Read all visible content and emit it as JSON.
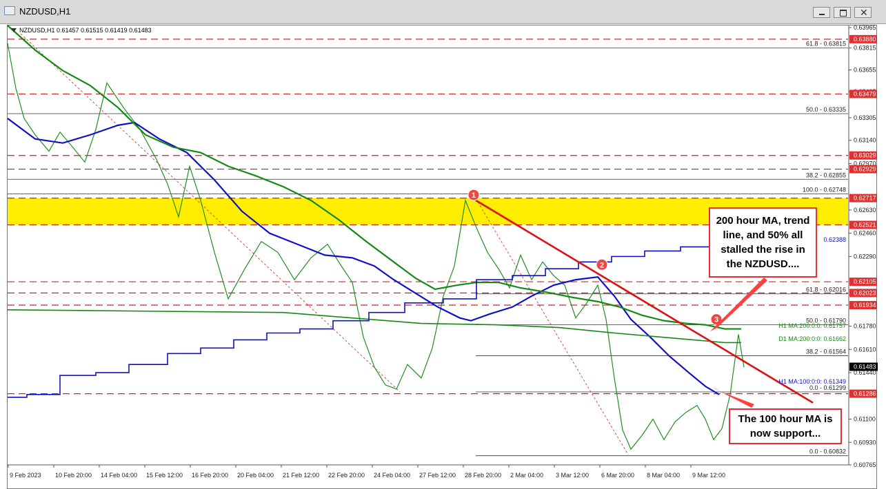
{
  "window": {
    "title": "NZDUSD,H1",
    "symbol_icon": "chart-window-icon",
    "buttons": [
      "minimize-icon",
      "restore-icon",
      "close-icon"
    ]
  },
  "chart_info": "NZDUSD,H1  0.61457 0.61515 0.61419 0.61483",
  "colors": {
    "candle": "#1f8f1f",
    "ma100": "#1010c8",
    "ma200": "#138a13",
    "trendline": "#e01010",
    "zone": "#ffee00",
    "level_line": "#cc2222",
    "price_tag": "#e03030"
  },
  "chart_data": {
    "type": "line",
    "symbol": "NZDUSD",
    "timeframe": "H1",
    "ylim": [
      0.60765,
      0.6398
    ],
    "x_ticks": [
      "9 Feb 2023",
      "10 Feb 20:00",
      "14 Feb 04:00",
      "15 Feb 12:00",
      "16 Feb 20:00",
      "20 Feb 04:00",
      "21 Feb 12:00",
      "22 Feb 20:00",
      "24 Feb 04:00",
      "27 Feb 12:00",
      "28 Feb 20:00",
      "2 Mar 04:00",
      "3 Mar 12:00",
      "6 Mar 20:00",
      "8 Mar 04:00",
      "9 Mar 12:00"
    ],
    "y_ticks": [
      "0.63965",
      "0.63815",
      "0.63655",
      "0.63495",
      "0.63305",
      "0.63140",
      "0.62970",
      "0.62630",
      "0.62460",
      "0.62290",
      "0.61780",
      "0.61610",
      "0.61440",
      "0.61100",
      "0.60930",
      "0.60765"
    ],
    "price_tags": [
      {
        "label": "0.63880",
        "value": 0.6388
      },
      {
        "label": "0.63479",
        "value": 0.63479
      },
      {
        "label": "0.63029",
        "value": 0.63029
      },
      {
        "label": "0.62929",
        "value": 0.62929
      },
      {
        "label": "0.62717",
        "value": 0.62717
      },
      {
        "label": "0.62521",
        "value": 0.62521
      },
      {
        "label": "0.62105",
        "value": 0.62105
      },
      {
        "label": "0.62023",
        "value": 0.62023
      },
      {
        "label": "0.61934",
        "value": 0.61934
      },
      {
        "label": "0.61286",
        "value": 0.61286
      }
    ],
    "current_price": {
      "label": "0.61483",
      "value": 0.61483
    },
    "resistance_zone": [
      0.62521,
      0.62717
    ],
    "fib_upper": [
      {
        "label": "61.8 - 0.63815",
        "value": 0.63815
      },
      {
        "label": "50.0 - 0.63335",
        "value": 0.63335
      },
      {
        "label": "38.2 - 0.62855",
        "value": 0.62855
      },
      {
        "label": "100.0 - 0.62748",
        "value": 0.62748
      }
    ],
    "fib_lower": [
      {
        "label": "61.8 - 0.62016",
        "value": 0.62016
      },
      {
        "label": "50.0 - 0.61790",
        "value": 0.6179
      },
      {
        "label": "38.2 - 0.61564",
        "value": 0.61564
      },
      {
        "label": "0.0 - 0.61299",
        "value": 0.61299
      },
      {
        "label": "0.0 - 0.60832",
        "value": 0.60832
      }
    ],
    "ma_labels": [
      {
        "label": "H1 MA:200:0:0: 0.61757",
        "value": 0.61757,
        "color": "#138a13"
      },
      {
        "label": "D1 MA:200:0:0: 0.61662",
        "value": 0.61662,
        "color": "#138a13"
      },
      {
        "label": "H1 MA:100:0:0: 0.61349",
        "value": 0.61349,
        "color": "#1010c8"
      },
      {
        "label": "0.62388",
        "value": 0.62388,
        "color": "#1010c8"
      }
    ],
    "series": [
      {
        "values": [
          [
            0,
            0.6385
          ],
          [
            6,
            0.6352
          ],
          [
            12,
            0.633
          ],
          [
            20,
            0.6318
          ],
          [
            30,
            0.6306
          ],
          [
            38,
            0.632
          ],
          [
            48,
            0.6308
          ],
          [
            56,
            0.6298
          ],
          [
            64,
            0.6322
          ],
          [
            72,
            0.6356
          ],
          [
            84,
            0.6338
          ],
          [
            96,
            0.6322
          ],
          [
            108,
            0.63
          ],
          [
            116,
            0.6282
          ],
          [
            124,
            0.6258
          ],
          [
            132,
            0.6295
          ],
          [
            140,
            0.627
          ],
          [
            150,
            0.6232
          ],
          [
            160,
            0.6198
          ],
          [
            172,
            0.622
          ],
          [
            184,
            0.624
          ],
          [
            196,
            0.6232
          ],
          [
            208,
            0.6212
          ],
          [
            220,
            0.6228
          ],
          [
            232,
            0.6238
          ],
          [
            242,
            0.6222
          ],
          [
            250,
            0.621
          ],
          [
            258,
            0.617
          ],
          [
            266,
            0.6148
          ],
          [
            274,
            0.6135
          ],
          [
            282,
            0.6132
          ],
          [
            290,
            0.615
          ],
          [
            300,
            0.614
          ],
          [
            308,
            0.6162
          ],
          [
            316,
            0.62
          ],
          [
            324,
            0.6222
          ],
          [
            332,
            0.627
          ],
          [
            340,
            0.625
          ],
          [
            348,
            0.6232
          ],
          [
            356,
            0.622
          ],
          [
            364,
            0.6206
          ],
          [
            372,
            0.623
          ],
          [
            380,
            0.6212
          ],
          [
            388,
            0.6225
          ],
          [
            396,
            0.6215
          ],
          [
            404,
            0.6208
          ],
          [
            412,
            0.6184
          ],
          [
            420,
            0.6195
          ],
          [
            428,
            0.6208
          ],
          [
            434,
            0.6183
          ],
          [
            440,
            0.614
          ],
          [
            446,
            0.6102
          ],
          [
            452,
            0.6088
          ],
          [
            460,
            0.6098
          ],
          [
            468,
            0.611
          ],
          [
            476,
            0.6095
          ],
          [
            484,
            0.6108
          ],
          [
            492,
            0.6115
          ],
          [
            500,
            0.612
          ],
          [
            506,
            0.611
          ],
          [
            512,
            0.6095
          ],
          [
            518,
            0.6103
          ],
          [
            524,
            0.6128
          ],
          [
            530,
            0.6172
          ],
          [
            534,
            0.6148
          ]
        ]
      },
      {
        "name": "H1 MA 100",
        "values": [
          [
            0,
            0.633
          ],
          [
            20,
            0.6315
          ],
          [
            40,
            0.6312
          ],
          [
            60,
            0.6318
          ],
          [
            80,
            0.6325
          ],
          [
            92,
            0.6327
          ],
          [
            110,
            0.6315
          ],
          [
            130,
            0.6305
          ],
          [
            150,
            0.6285
          ],
          [
            170,
            0.6262
          ],
          [
            190,
            0.6246
          ],
          [
            210,
            0.6238
          ],
          [
            230,
            0.623
          ],
          [
            250,
            0.6228
          ],
          [
            266,
            0.6222
          ],
          [
            280,
            0.6212
          ],
          [
            296,
            0.6202
          ],
          [
            312,
            0.6192
          ],
          [
            328,
            0.6184
          ],
          [
            336,
            0.6182
          ],
          [
            350,
            0.6187
          ],
          [
            366,
            0.6192
          ],
          [
            380,
            0.62
          ],
          [
            396,
            0.6208
          ],
          [
            412,
            0.6212
          ],
          [
            428,
            0.6214
          ],
          [
            440,
            0.62
          ],
          [
            452,
            0.6183
          ],
          [
            466,
            0.617
          ],
          [
            480,
            0.6156
          ],
          [
            494,
            0.6144
          ],
          [
            506,
            0.6134
          ],
          [
            516,
            0.6128
          ]
        ]
      },
      {
        "name": "H1 MA 200",
        "values": [
          [
            0,
            0.6398
          ],
          [
            20,
            0.638
          ],
          [
            40,
            0.6365
          ],
          [
            60,
            0.6354
          ],
          [
            80,
            0.6338
          ],
          [
            100,
            0.6318
          ],
          [
            120,
            0.6309
          ],
          [
            140,
            0.6305
          ],
          [
            160,
            0.6295
          ],
          [
            180,
            0.6288
          ],
          [
            200,
            0.628
          ],
          [
            220,
            0.627
          ],
          [
            240,
            0.6256
          ],
          [
            260,
            0.624
          ],
          [
            280,
            0.6225
          ],
          [
            296,
            0.6213
          ],
          [
            310,
            0.6205
          ],
          [
            326,
            0.6208
          ],
          [
            340,
            0.621
          ],
          [
            356,
            0.621
          ],
          [
            372,
            0.6206
          ],
          [
            390,
            0.6203
          ],
          [
            410,
            0.6199
          ],
          [
            428,
            0.6196
          ],
          [
            444,
            0.6192
          ],
          [
            460,
            0.6186
          ],
          [
            476,
            0.6182
          ],
          [
            492,
            0.618
          ],
          [
            506,
            0.6179
          ],
          [
            520,
            0.6176
          ],
          [
            532,
            0.6176
          ]
        ]
      },
      {
        "name": "D1 MA 200",
        "values": [
          [
            0,
            0.619
          ],
          [
            100,
            0.6189
          ],
          [
            200,
            0.6188
          ],
          [
            300,
            0.618
          ],
          [
            354,
            0.6179
          ],
          [
            400,
            0.6177
          ],
          [
            440,
            0.6173
          ],
          [
            474,
            0.617
          ],
          [
            520,
            0.6166
          ],
          [
            532,
            0.6166
          ]
        ]
      },
      {
        "name": "D1 MA 100",
        "values": [
          [
            0,
            0.6126
          ],
          [
            14,
            0.6126
          ],
          [
            14,
            0.6128
          ],
          [
            38,
            0.6128
          ],
          [
            38,
            0.6142
          ],
          [
            64,
            0.6142
          ],
          [
            64,
            0.6144
          ],
          [
            88,
            0.6144
          ],
          [
            88,
            0.615
          ],
          [
            116,
            0.615
          ],
          [
            116,
            0.6158
          ],
          [
            140,
            0.6158
          ],
          [
            140,
            0.6162
          ],
          [
            164,
            0.6162
          ],
          [
            164,
            0.6168
          ],
          [
            188,
            0.6168
          ],
          [
            188,
            0.6173
          ],
          [
            212,
            0.6173
          ],
          [
            212,
            0.6176
          ],
          [
            236,
            0.6176
          ],
          [
            236,
            0.6182
          ],
          [
            262,
            0.6182
          ],
          [
            262,
            0.6188
          ],
          [
            288,
            0.6188
          ],
          [
            288,
            0.6195
          ],
          [
            316,
            0.6195
          ],
          [
            316,
            0.6198
          ],
          [
            340,
            0.6198
          ],
          [
            340,
            0.6212
          ],
          [
            366,
            0.6212
          ],
          [
            366,
            0.6215
          ],
          [
            390,
            0.6215
          ],
          [
            390,
            0.622
          ],
          [
            414,
            0.622
          ],
          [
            414,
            0.6225
          ],
          [
            438,
            0.6225
          ],
          [
            438,
            0.6229
          ],
          [
            462,
            0.6229
          ],
          [
            462,
            0.6233
          ],
          [
            488,
            0.6233
          ],
          [
            488,
            0.6236
          ],
          [
            514,
            0.6236
          ],
          [
            514,
            0.6239
          ],
          [
            532,
            0.6239
          ]
        ]
      }
    ],
    "trendline": [
      [
        338,
        0.6271
      ],
      [
        584,
        0.6122
      ]
    ],
    "markers": [
      {
        "label": "1",
        "x": 338,
        "y": 0.6274
      },
      {
        "label": "2",
        "x": 431,
        "y": 0.6223
      },
      {
        "label": "3",
        "x": 514,
        "y": 0.6183
      }
    ]
  },
  "annotations": {
    "top_callout": "200 hour MA, trend line, and 50% all stalled the rise in the NZDUSD....",
    "bottom_callout": "The 100 hour MA is now support..."
  }
}
